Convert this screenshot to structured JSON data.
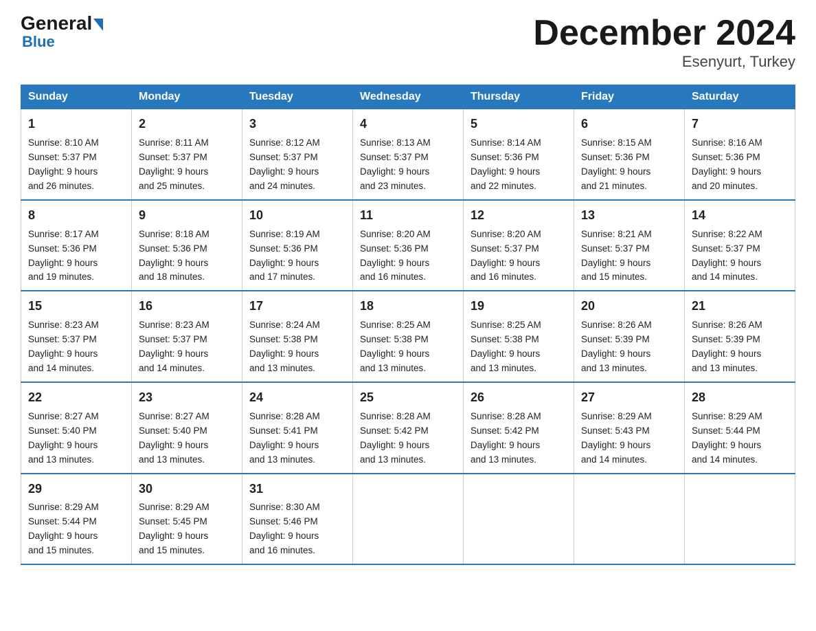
{
  "logo": {
    "general": "General",
    "blue": "Blue"
  },
  "title": "December 2024",
  "subtitle": "Esenyurt, Turkey",
  "days": [
    "Sunday",
    "Monday",
    "Tuesday",
    "Wednesday",
    "Thursday",
    "Friday",
    "Saturday"
  ],
  "weeks": [
    [
      {
        "num": "1",
        "sunrise": "8:10 AM",
        "sunset": "5:37 PM",
        "daylight": "9 hours and 26 minutes."
      },
      {
        "num": "2",
        "sunrise": "8:11 AM",
        "sunset": "5:37 PM",
        "daylight": "9 hours and 25 minutes."
      },
      {
        "num": "3",
        "sunrise": "8:12 AM",
        "sunset": "5:37 PM",
        "daylight": "9 hours and 24 minutes."
      },
      {
        "num": "4",
        "sunrise": "8:13 AM",
        "sunset": "5:37 PM",
        "daylight": "9 hours and 23 minutes."
      },
      {
        "num": "5",
        "sunrise": "8:14 AM",
        "sunset": "5:36 PM",
        "daylight": "9 hours and 22 minutes."
      },
      {
        "num": "6",
        "sunrise": "8:15 AM",
        "sunset": "5:36 PM",
        "daylight": "9 hours and 21 minutes."
      },
      {
        "num": "7",
        "sunrise": "8:16 AM",
        "sunset": "5:36 PM",
        "daylight": "9 hours and 20 minutes."
      }
    ],
    [
      {
        "num": "8",
        "sunrise": "8:17 AM",
        "sunset": "5:36 PM",
        "daylight": "9 hours and 19 minutes."
      },
      {
        "num": "9",
        "sunrise": "8:18 AM",
        "sunset": "5:36 PM",
        "daylight": "9 hours and 18 minutes."
      },
      {
        "num": "10",
        "sunrise": "8:19 AM",
        "sunset": "5:36 PM",
        "daylight": "9 hours and 17 minutes."
      },
      {
        "num": "11",
        "sunrise": "8:20 AM",
        "sunset": "5:36 PM",
        "daylight": "9 hours and 16 minutes."
      },
      {
        "num": "12",
        "sunrise": "8:20 AM",
        "sunset": "5:37 PM",
        "daylight": "9 hours and 16 minutes."
      },
      {
        "num": "13",
        "sunrise": "8:21 AM",
        "sunset": "5:37 PM",
        "daylight": "9 hours and 15 minutes."
      },
      {
        "num": "14",
        "sunrise": "8:22 AM",
        "sunset": "5:37 PM",
        "daylight": "9 hours and 14 minutes."
      }
    ],
    [
      {
        "num": "15",
        "sunrise": "8:23 AM",
        "sunset": "5:37 PM",
        "daylight": "9 hours and 14 minutes."
      },
      {
        "num": "16",
        "sunrise": "8:23 AM",
        "sunset": "5:37 PM",
        "daylight": "9 hours and 14 minutes."
      },
      {
        "num": "17",
        "sunrise": "8:24 AM",
        "sunset": "5:38 PM",
        "daylight": "9 hours and 13 minutes."
      },
      {
        "num": "18",
        "sunrise": "8:25 AM",
        "sunset": "5:38 PM",
        "daylight": "9 hours and 13 minutes."
      },
      {
        "num": "19",
        "sunrise": "8:25 AM",
        "sunset": "5:38 PM",
        "daylight": "9 hours and 13 minutes."
      },
      {
        "num": "20",
        "sunrise": "8:26 AM",
        "sunset": "5:39 PM",
        "daylight": "9 hours and 13 minutes."
      },
      {
        "num": "21",
        "sunrise": "8:26 AM",
        "sunset": "5:39 PM",
        "daylight": "9 hours and 13 minutes."
      }
    ],
    [
      {
        "num": "22",
        "sunrise": "8:27 AM",
        "sunset": "5:40 PM",
        "daylight": "9 hours and 13 minutes."
      },
      {
        "num": "23",
        "sunrise": "8:27 AM",
        "sunset": "5:40 PM",
        "daylight": "9 hours and 13 minutes."
      },
      {
        "num": "24",
        "sunrise": "8:28 AM",
        "sunset": "5:41 PM",
        "daylight": "9 hours and 13 minutes."
      },
      {
        "num": "25",
        "sunrise": "8:28 AM",
        "sunset": "5:42 PM",
        "daylight": "9 hours and 13 minutes."
      },
      {
        "num": "26",
        "sunrise": "8:28 AM",
        "sunset": "5:42 PM",
        "daylight": "9 hours and 13 minutes."
      },
      {
        "num": "27",
        "sunrise": "8:29 AM",
        "sunset": "5:43 PM",
        "daylight": "9 hours and 14 minutes."
      },
      {
        "num": "28",
        "sunrise": "8:29 AM",
        "sunset": "5:44 PM",
        "daylight": "9 hours and 14 minutes."
      }
    ],
    [
      {
        "num": "29",
        "sunrise": "8:29 AM",
        "sunset": "5:44 PM",
        "daylight": "9 hours and 15 minutes."
      },
      {
        "num": "30",
        "sunrise": "8:29 AM",
        "sunset": "5:45 PM",
        "daylight": "9 hours and 15 minutes."
      },
      {
        "num": "31",
        "sunrise": "8:30 AM",
        "sunset": "5:46 PM",
        "daylight": "9 hours and 16 minutes."
      },
      null,
      null,
      null,
      null
    ]
  ]
}
